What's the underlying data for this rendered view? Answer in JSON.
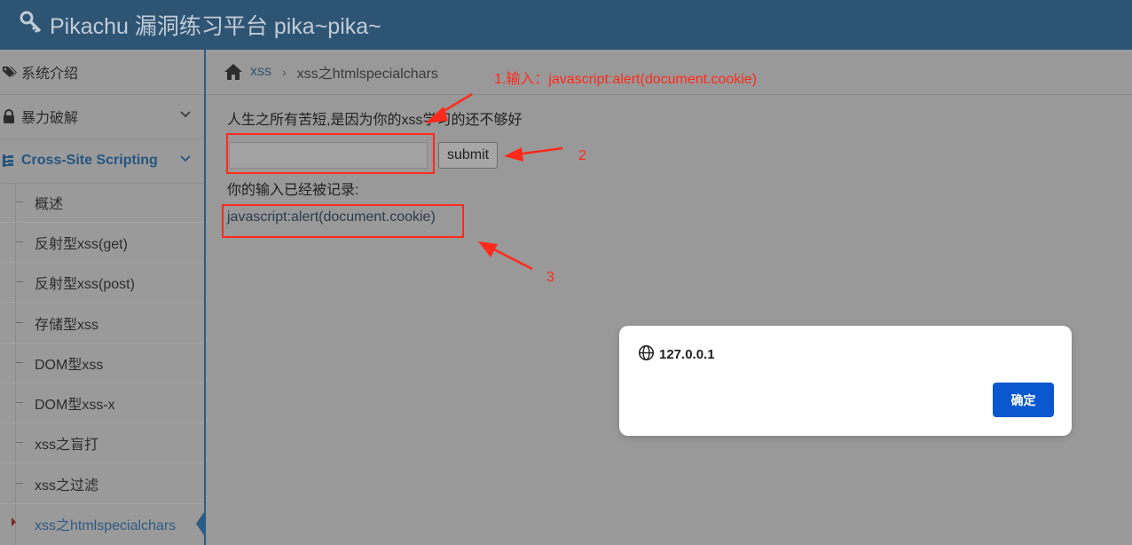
{
  "header": {
    "title": "Pikachu 漏洞练习平台 pika~pika~",
    "icon": "key-icon"
  },
  "sidebar": {
    "items": [
      {
        "label": "系统介绍",
        "icon": "tags-icon"
      },
      {
        "label": "暴力破解",
        "icon": "lock-icon"
      },
      {
        "label": "Cross-Site Scripting",
        "icon": "sitemap-icon",
        "active": true
      }
    ],
    "subitems": [
      {
        "label": "概述"
      },
      {
        "label": "反射型xss(get)"
      },
      {
        "label": "反射型xss(post)"
      },
      {
        "label": "存储型xss"
      },
      {
        "label": "DOM型xss"
      },
      {
        "label": "DOM型xss-x"
      },
      {
        "label": "xss之盲打"
      },
      {
        "label": "xss之过滤"
      },
      {
        "label": "xss之htmlspecialchars",
        "current": true
      }
    ]
  },
  "breadcrumb": {
    "home_icon": "home-icon",
    "link": "xss",
    "current": "xss之htmlspecialchars"
  },
  "main": {
    "prompt": "人生之所有苦短,是因为你的xss学习的还不够好",
    "input_value": "",
    "submit_label": "submit",
    "record_label": "你的输入已经被记录:",
    "record_value": "javascript:alert(document.cookie)"
  },
  "annotations": {
    "note1": "1.输入：javascript:alert(document.cookie)",
    "note2": "2",
    "note3": "3",
    "color": "#ff2a1a"
  },
  "dialog": {
    "origin": "127.0.0.1",
    "ok_label": "确定",
    "icon": "globe-icon"
  },
  "colors": {
    "header": "#2e5474",
    "accent": "#2b5c86",
    "dialog_button": "#0b57d0"
  }
}
